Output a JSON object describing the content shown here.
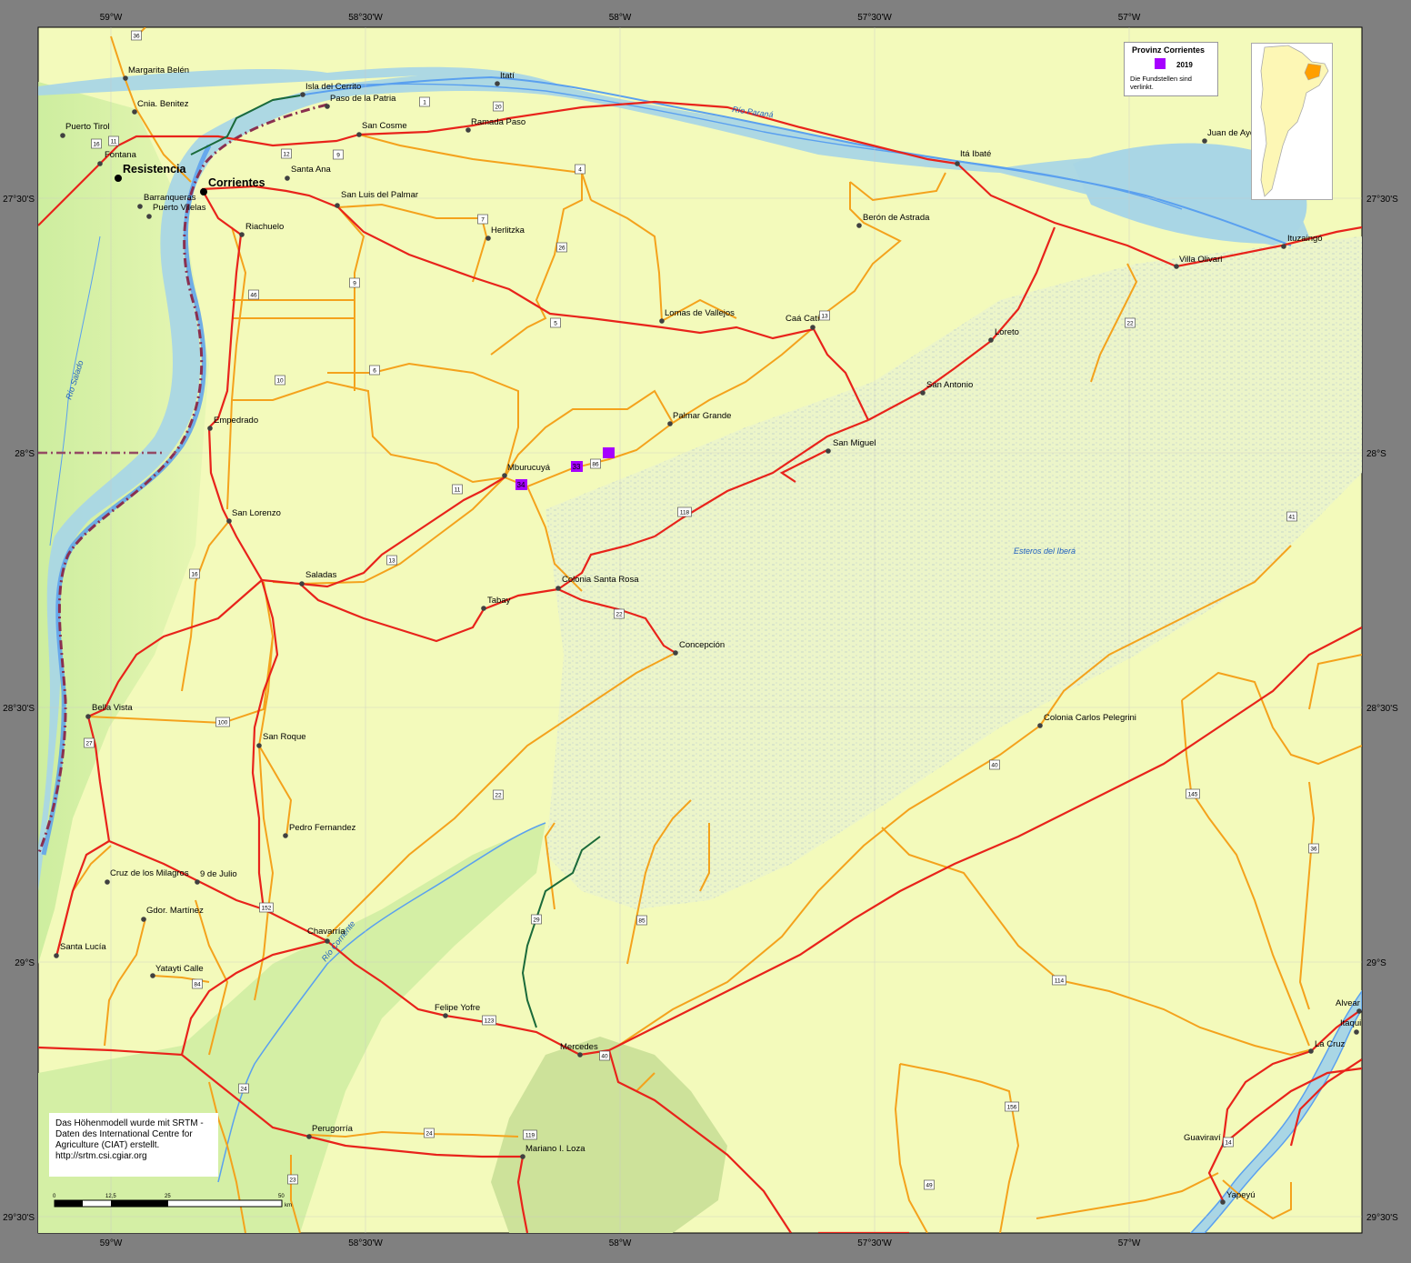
{
  "map": {
    "graticule_labels": {
      "top": [
        "59°W",
        "58°30'W",
        "58°W",
        "57°30'W",
        "57°W"
      ],
      "bottom": [
        "59°W",
        "58°30'W",
        "58°W",
        "57°30'W",
        "57°W"
      ],
      "left": [
        "27°30'S",
        "28°S",
        "28°30'S",
        "29°S",
        "29°30'S"
      ],
      "right": [
        "27°30'S",
        "28°S",
        "28°30'S",
        "29°S",
        "29°30'S"
      ]
    },
    "cities": [
      "Resistencia",
      "Corrientes"
    ],
    "towns": [
      "Margarita Belén",
      "Cnia. Benitez",
      "Puerto Tirol",
      "Fontana",
      "Barranqueras",
      "Puerto Vilelas",
      "Isla del Cerrito",
      "Paso de la Patria",
      "Itatí",
      "San Cosme",
      "Ramada Paso",
      "Santa Ana",
      "San Luis del Palmar",
      "Riachuelo",
      "Herlitzka",
      "Itá Ibaté",
      "Berón de Astrada",
      "Juan de Ayo",
      "Ituzaingó",
      "Villa Olivari",
      "Lomas de Vallejos",
      "Caá Catí",
      "Loreto",
      "San Antonio",
      "Palmar Grande",
      "San Miguel",
      "Mburucuyá",
      "Empedrado",
      "San Lorenzo",
      "Saladas",
      "Colonia Santa Rosa",
      "Tabay",
      "Concepción",
      "Bella Vista",
      "San Roque",
      "Colonia Carlos Pelegrini",
      "Pedro Fernandez",
      "Cruz de los Milagros",
      "9 de Julio",
      "Gdor. Martínez",
      "Santa Lucía",
      "Chavarría",
      "Yatayti Calle",
      "Felipe Yofre",
      "Mercedes",
      "Alvear",
      "Itaqui",
      "La Cruz",
      "Perugorría",
      "Mariano I. Loza",
      "Guaviraví",
      "Yapeyú"
    ],
    "water_labels": [
      "Río Paraná",
      "Río Salado",
      "Esteros del Iberá",
      "Río Corriente"
    ],
    "route_shields": [
      "36",
      "11",
      "16",
      "12",
      "9",
      "1",
      "20",
      "4",
      "7",
      "26",
      "9",
      "46",
      "5",
      "13",
      "10",
      "6",
      "11",
      "86",
      "118",
      "13",
      "16",
      "22",
      "41",
      "22",
      "100",
      "27",
      "40",
      "22",
      "145",
      "36",
      "29",
      "85",
      "152",
      "84",
      "123",
      "40",
      "114",
      "24",
      "24",
      "119",
      "156",
      "14",
      "23",
      "49"
    ],
    "findspots": [
      "33",
      "34"
    ]
  },
  "legend": {
    "title": "Provinz Corrientes",
    "year": "2019",
    "note": "Die Fundstellen sind verlinkt.",
    "swatch_color": "#a600ff"
  },
  "credit": {
    "lines": [
      "Das Höhenmodell wurde mit SRTM -",
      "Daten des International Centre for",
      "Agriculture (CIAT) erstellt.",
      "http://srtm.csi.cgiar.org"
    ]
  },
  "scale_bar": {
    "ticks": [
      "0",
      "12,5",
      "25",
      "50"
    ],
    "unit": "km"
  },
  "colors": {
    "land": "#f3fabb",
    "lowland": "#d6f0a8",
    "water": "#a9d6e5",
    "river": "#5aa0ef",
    "national_road": "#e8231b",
    "provincial_road": "#f4a21c",
    "border": "#8a2f4f",
    "findspot": "#a600ff"
  }
}
